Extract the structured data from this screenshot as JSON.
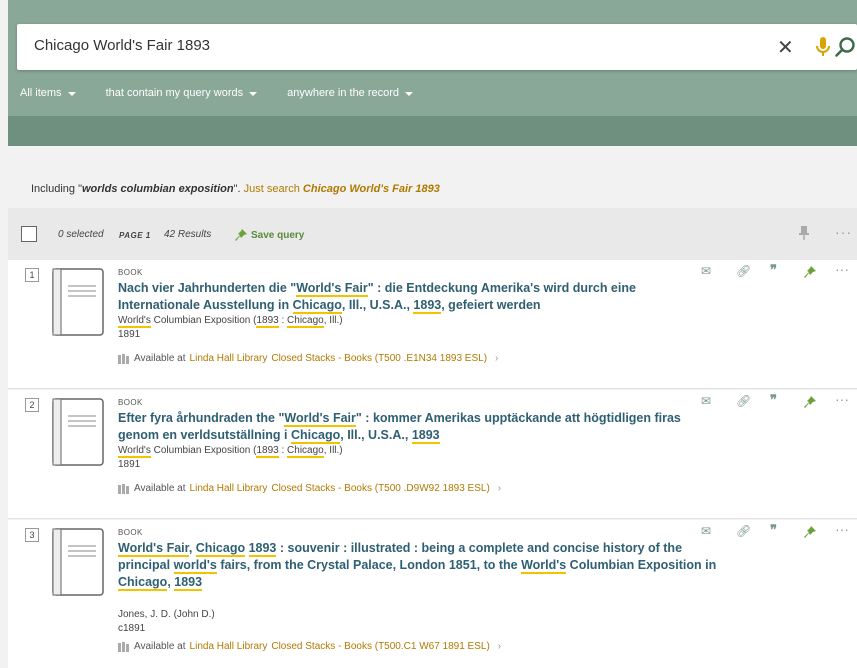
{
  "search": {
    "query": "Chicago World's Fair 1893",
    "clear_icon": "close-icon",
    "mic_icon": "microphone-icon",
    "search_icon": "search-icon"
  },
  "filters": [
    {
      "label": "All items"
    },
    {
      "label": "that contain my query words"
    },
    {
      "label": "anywhere in the record"
    }
  ],
  "including": {
    "prefix": "Including \"",
    "term": "worlds columbian exposition",
    "suffix": "\".",
    "just_search": "Just search",
    "original": "Chicago World's Fair 1893"
  },
  "toolbar": {
    "selected": "0 selected",
    "page": "PAGE 1",
    "results": "42 Results",
    "save_query": "Save query"
  },
  "results": [
    {
      "num": "1",
      "type": "BOOK",
      "title_html": "Nach vier Jahrhunderten die \"<span class='hl'>World's Fair</span>\" : die Entdeckung Amerika's wird durch eine Internationale Ausstellung in <span class='hl'>Chicago</span>, Ill., U.S.A., <span class='hl'>1893</span>, gefeiert werden",
      "author_html": "<span class='hl'>World's</span> Columbian Exposition (<span class='hl'>1893</span> : <span class='hl'>Chicago</span>, Ill.)",
      "date": "1891",
      "available": "Available at",
      "library": "Linda Hall Library",
      "location": "Closed Stacks - Books (T500 .E1N34 1893 ESL)"
    },
    {
      "num": "2",
      "type": "BOOK",
      "title_html": "Efter fyra århundraden the \"<span class='hl'>World's Fair</span>\" : kommer Amerikas upptäckande att högtidligen firas genom en verldsutställning i <span class='hl'>Chicago</span>, Ill., U.S.A., <span class='hl'>1893</span>",
      "author_html": "<span class='hl'>World's</span> Columbian Exposition (<span class='hl'>1893</span> : <span class='hl'>Chicago</span>, Ill.)",
      "date": "1891",
      "available": "Available at",
      "library": "Linda Hall Library",
      "location": "Closed Stacks - Books (T500 .D9W92 1893 ESL)"
    },
    {
      "num": "3",
      "type": "BOOK",
      "title_html": "<span class='hl'>World's Fair</span>, <span class='hl'>Chicago</span> <span class='hl'>1893</span> : souvenir : illustrated : being a complete and concise history of the principal <span class='hl'>world's</span> fairs, from the Crystal Palace, London 1851, to the <span class='hl'>World's</span> Columbian Exposition in <span class='hl'>Chicago</span>, <span class='hl'>1893</span>",
      "author_html": "Jones, J. D. (John D.)",
      "date": "c1891",
      "available": "Available at",
      "library": "Linda Hall Library",
      "location": "Closed Stacks - Books (T500.C1 W67 1891 ESL)"
    }
  ],
  "colors": {
    "header": "#8aa898",
    "accent": "#b07a00",
    "title": "#2f5f72",
    "highlight": "#f2c400"
  }
}
